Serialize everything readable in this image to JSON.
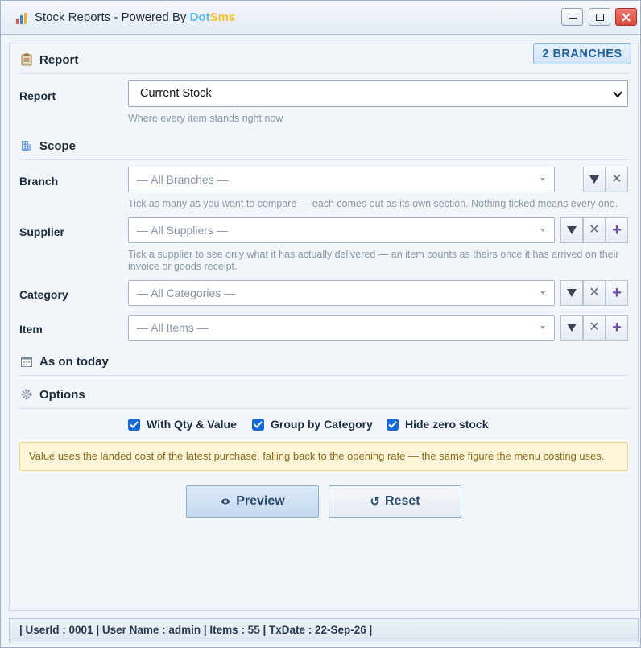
{
  "window": {
    "title_prefix": "Stock Reports - Powered By ",
    "brand_part1": "Dot",
    "brand_part2": "Sms",
    "brand_colors": {
      "dot": "#5bb7f0",
      "sms": "#f2c230"
    },
    "controls": [
      "minimize-icon",
      "maximize-icon",
      "close-icon"
    ]
  },
  "badge": {
    "branches": "2 BRANCHES"
  },
  "sections": {
    "report": "Report",
    "scope": "Scope",
    "as_on": "As on today",
    "options": "Options"
  },
  "report": {
    "label": "Report",
    "selected": "Current Stock",
    "hint": "Where every item stands right now"
  },
  "scope": {
    "branch": {
      "label": "Branch",
      "placeholder": "— All Branches —",
      "hint": "Tick as many as you want to compare — each comes out as its own section. Nothing ticked means every one."
    },
    "supplier": {
      "label": "Supplier",
      "placeholder": "— All Suppliers —",
      "hint_line1": "Tick a supplier to see only what it has actually delivered — an item counts as theirs once it has arrived on their",
      "hint_line2": "invoice or goods receipt."
    },
    "category": {
      "label": "Category",
      "placeholder": "— All Categories —"
    },
    "item": {
      "label": "Item",
      "placeholder": "— All Items —"
    }
  },
  "options": {
    "qty_value": {
      "label": "With Qty & Value",
      "checked": true
    },
    "group_category": {
      "label": "Group by Category",
      "checked": true
    },
    "hide_zero": {
      "label": "Hide zero stock",
      "checked": true
    }
  },
  "note": "Value uses the landed cost of the latest purchase, falling back to the opening rate — the same figure the menu costing uses.",
  "buttons": {
    "preview": "Preview",
    "reset": "Reset"
  },
  "status": "| UserId : 0001  |  User Name : admin  |  Items : 55  |  TxDate : 22-Sep-26 |",
  "colors": {
    "accent": "#1769d6",
    "badge_text": "#1f5f98",
    "note_bg": "#fdf5d8",
    "plus": "#6a4aa8"
  }
}
